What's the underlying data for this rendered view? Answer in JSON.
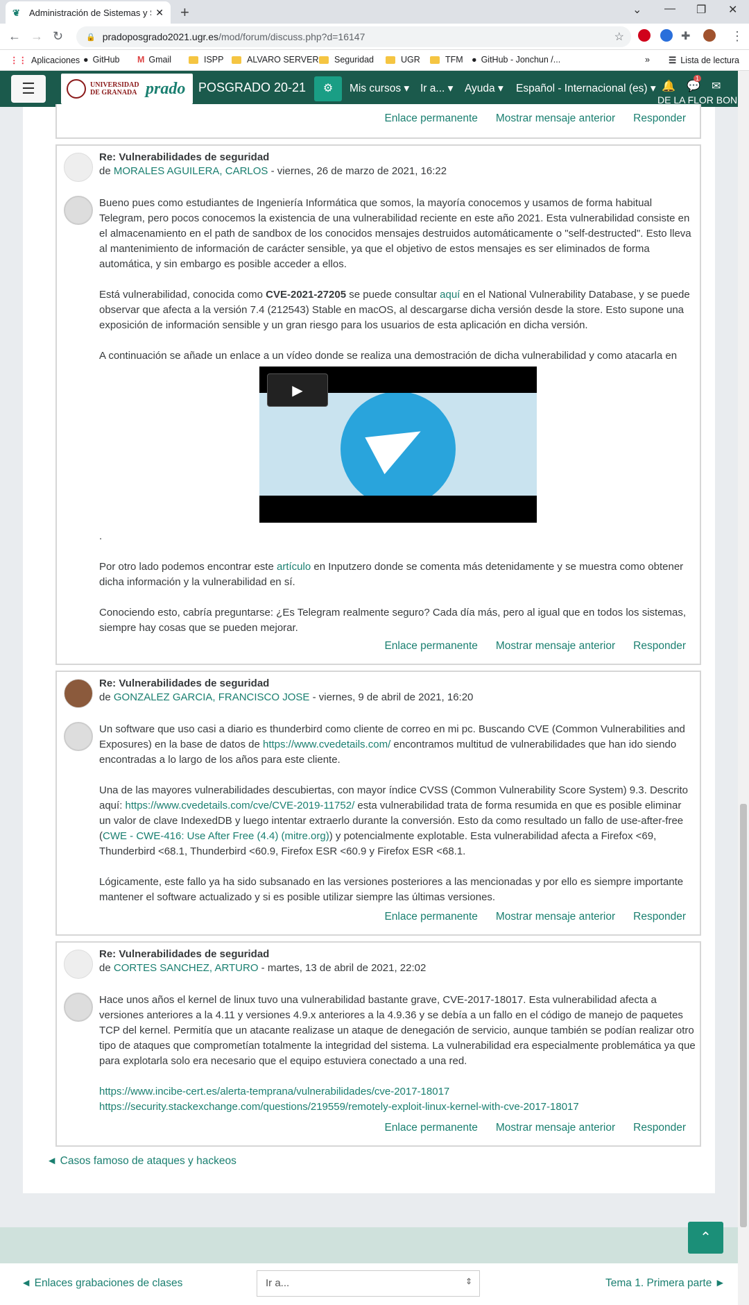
{
  "browser": {
    "tab_title": "Administración de Sistemas y Se...",
    "url_host": "pradoposgrado2021.ugr.es",
    "url_path": "/mod/forum/discuss.php?d=16147",
    "bookmarks": [
      "Aplicaciones",
      "GitHub",
      "Gmail",
      "ISPP",
      "ALVARO SERVER",
      "Seguridad",
      "UGR",
      "TFM",
      "GitHub - Jonchun /..."
    ],
    "reading_list": "Lista de lectura"
  },
  "nav": {
    "logo_text": "UNIVERSIDAD DE GRANADA",
    "logo_brand": "prado",
    "site_name": "POSGRADO 20-21",
    "menu": [
      "Mis cursos",
      "Ir a...",
      "Ayuda",
      "Español - Internacional (es)"
    ],
    "user": "DE LA FLOR BONI",
    "notif_count": "1"
  },
  "commands": {
    "permalink": "Enlace permanente",
    "parent": "Mostrar mensaje anterior",
    "reply": "Responder"
  },
  "posts": [
    {
      "subject": "Re: Vulnerabilidades de seguridad",
      "by": "de",
      "author": "MORALES AGUILERA, CARLOS",
      "date": " - viernes, 26 de marzo de 2021, 16:22",
      "p1": "Bueno pues como estudiantes de Ingeniería Informática que somos, la mayoría conocemos y usamos de forma habitual Telegram, pero pocos conocemos la existencia de una vulnerabilidad reciente en este año 2021. Esta vulnerabilidad consiste en el almacenamiento en el path de sandbox de los conocidos mensajes destruidos automáticamente o \"self-destructed\". Esto lleva al mantenimiento de información de carácter sensible, ya que el objetivo de estos mensajes es ser eliminados de forma automática, y sin embargo es posible acceder a ellos.",
      "p2a": "Está vulnerabilidad, conocida como ",
      "cve": "CVE-2021-27205",
      "p2b": " se puede consultar ",
      "link_aqui": "aquí",
      "p2c": " en el National Vulnerability Database, y se puede observar que afecta a la versión 7.4 (212543) Stable en macOS, al descargarse dicha versión desde la store. Esto supone una exposición de información sensible y un gran riesgo para los usuarios de esta aplicación en dicha versión.",
      "p3": "A continuación se añade un enlace a un vídeo donde se realiza una demostración de dicha vulnerabilidad y como atacarla en",
      "dot": ".",
      "p4a": "Por otro lado podemos encontrar este ",
      "link_articulo": "artículo",
      "p4b": " en Inputzero donde se comenta más detenidamente y se muestra como obtener dicha información y la vulnerabilidad en sí.",
      "p5": "Conociendo esto, cabría preguntarse: ¿Es Telegram realmente seguro? Cada día más, pero al igual que en todos los sistemas, siempre hay cosas que se pueden mejorar."
    },
    {
      "subject": "Re: Vulnerabilidades de seguridad",
      "by": "de",
      "author": "GONZALEZ GARCIA, FRANCISCO JOSE",
      "date": " - viernes, 9 de abril de 2021, 16:20",
      "p1a": "Un software que uso casi a diario es thunderbird como cliente de correo en mi pc. Buscando CVE (Common Vulnerabilities and Exposures) en la base de datos de ",
      "link1": "https://www.cvedetails.com/",
      "p1b": " encontramos multitud de vulnerabilidades que han ido siendo encontradas a lo largo de los años para este cliente.",
      "p2a": "Una de las mayores vulnerabilidades descubiertas, con mayor índice CVSS (Common Vulnerability Score System) 9.3. Descrito aquí: ",
      "link2": "https://www.cvedetails.com/cve/CVE-2019-11752/",
      "p2b": " esta vulnerabilidad trata de forma resumida en que es posible eliminar un valor de clave IndexedDB y luego intentar extraerlo durante la conversión. Esto da como resultado un fallo de use-after-free (",
      "link3": "CWE - CWE-416: Use After Free (4.4) (mitre.org)",
      "p2c": ") y potencialmente explotable. Esta vulnerabilidad afecta a Firefox <69, Thunderbird <68.1, Thunderbird <60.9, Firefox ESR <60.9 y Firefox ESR <68.1.",
      "p3": "Lógicamente, este fallo ya ha sido subsanado en las versiones posteriores a las mencionadas y por ello es siempre importante mantener el software actualizado y si es posible utilizar siempre las últimas versiones."
    },
    {
      "subject": "Re: Vulnerabilidades de seguridad",
      "by": "de",
      "author": "CORTES SANCHEZ, ARTURO",
      "date": " - martes, 13 de abril de 2021, 22:02",
      "p1": "Hace unos años el kernel de linux tuvo una vulnerabilidad bastante grave, CVE-2017-18017. Esta vulnerabilidad afecta a versiones anteriores a la 4.11 y versiones 4.9.x anteriores a la 4.9.36 y se debía a un fallo en el código de manejo de paquetes TCP del kernel. Permitía que un atacante realizase un ataque de denegación de servicio, aunque también se podían realizar otro tipo de ataques que comprometían totalmente la integridad del sistema. La vulnerabilidad era especialmente problemática ya que para explotarla solo era necesario que el equipo estuviera conectado a una red.",
      "link1": "https://www.incibe-cert.es/alerta-temprana/vulnerabilidades/cve-2017-18017",
      "link2": "https://security.stackexchange.com/questions/219559/remotely-exploit-linux-kernel-with-cve-2017-18017"
    }
  ],
  "back_link": "◄ Casos famoso de ataques y hackeos",
  "footer": {
    "prev": "◄ Enlaces grabaciones de clases",
    "jump": "Ir a...",
    "next": "Tema 1. Primera parte ►"
  }
}
